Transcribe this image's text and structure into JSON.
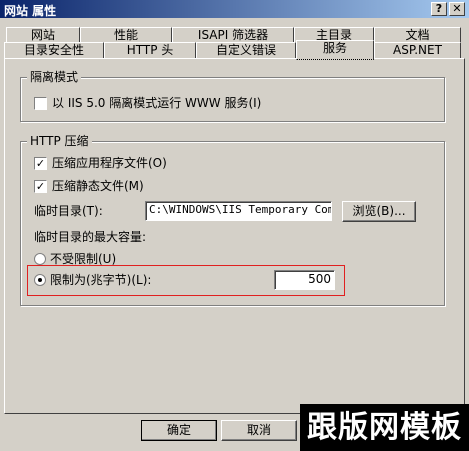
{
  "window": {
    "title": "网站 属性",
    "help_glyph": "?",
    "close_glyph": "✕"
  },
  "tabs_row1": [
    "网站",
    "性能",
    "ISAPI 筛选器",
    "主目录",
    "文档"
  ],
  "tabs_row2": [
    "目录安全性",
    "HTTP 头",
    "自定义错误",
    "服务",
    "ASP.NET"
  ],
  "isolation": {
    "group_title": "隔离模式",
    "checkbox_label": "以 IIS 5.0 隔离模式运行 WWW 服务(I)",
    "checked": false
  },
  "compression": {
    "group_title": "HTTP 压缩",
    "app_files_label": "压缩应用程序文件(O)",
    "app_files_checked": true,
    "static_files_label": "压缩静态文件(M)",
    "static_files_checked": true,
    "temp_dir_label": "临时目录(T):",
    "temp_dir_value": "C:\\WINDOWS\\IIS Temporary Compr",
    "browse_label": "浏览(B)...",
    "max_size_label": "临时目录的最大容量:",
    "unlimited_label": "不受限制(U)",
    "limit_label": "限制为(兆字节)(L):",
    "limit_value": "500",
    "selected_option": "limit"
  },
  "footer": {
    "ok_label": "确定",
    "cancel_label": "取消"
  },
  "watermark_text": "跟版网模板",
  "colors": {
    "dialog_bg": "#d4d0c8",
    "title_start": "#0a246a",
    "title_end": "#a6caf0",
    "highlight": "#e02020"
  }
}
